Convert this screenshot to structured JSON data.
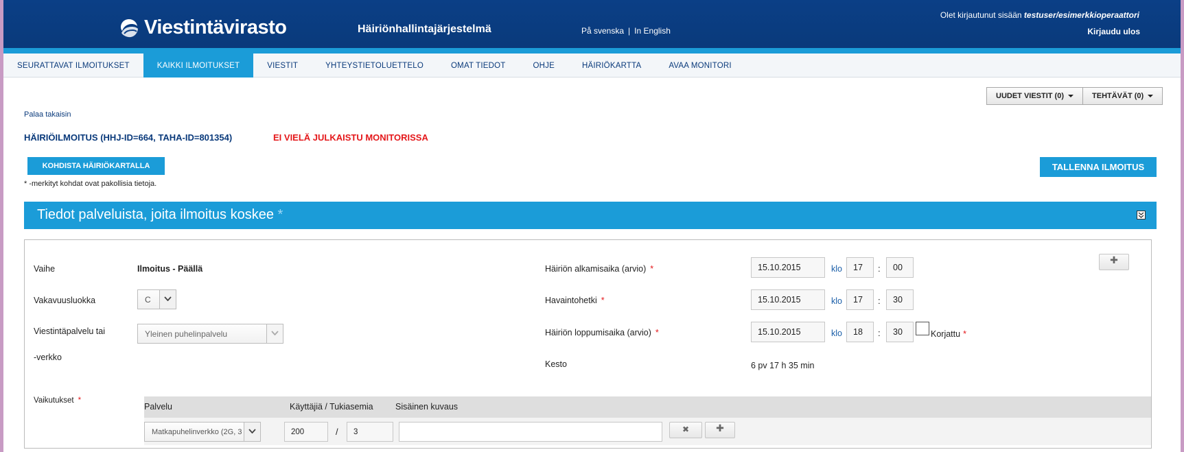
{
  "header": {
    "logo_text": "Viestintävirasto",
    "app_title": "Häiriönhallintajärjestelmä",
    "lang_sv": "På svenska",
    "lang_sep": "|",
    "lang_en": "In English",
    "login_prefix": "Olet kirjautunut sisään",
    "login_user": "testuser/esimerkkioperaattori",
    "logout": "Kirjaudu ulos"
  },
  "nav": {
    "items": [
      {
        "label": "SEURATTAVAT ILMOITUKSET"
      },
      {
        "label": "KAIKKI ILMOITUKSET"
      },
      {
        "label": "VIESTIT"
      },
      {
        "label": "YHTEYSTIETOLUETTELO"
      },
      {
        "label": "OMAT TIEDOT"
      },
      {
        "label": "OHJE"
      },
      {
        "label": "HÄIRIÖKARTTA"
      },
      {
        "label": "AVAA MONITORI"
      }
    ],
    "active_index": 1
  },
  "toolbar": {
    "new_messages": "UUDET VIESTIT (0)",
    "tasks": "TEHTÄVÄT (0)"
  },
  "page": {
    "back_link": "Palaa takaisin",
    "title": "HÄIRIÖILMOITUS (HHJ-ID=664, TAHA-ID=801354)",
    "status": "EI VIELÄ JULKAISTU MONITORISSA",
    "map_button": "KOHDISTA HÄIRIÖKARTALLA",
    "save_button": "TALLENNA ILMOITUS",
    "required_note": "* -merkityt kohdat ovat pakollisia tietoja."
  },
  "section": {
    "title": "Tiedot palveluista, joita ilmoitus koskee",
    "required_mark": "*"
  },
  "form": {
    "phase_label": "Vaihe",
    "phase_value": "Ilmoitus - Päällä",
    "severity_label": "Vakavuusluokka",
    "severity_value": "C",
    "service_label_1": "Viestintäpalvelu tai",
    "service_label_2": "-verkko",
    "service_value": "Yleinen puhelinpalvelu",
    "start_label": "Häiriön alkamisaika (arvio)",
    "start_date": "15.10.2015",
    "start_hour": "17",
    "start_min": "00",
    "observed_label": "Havaintohetki",
    "observed_date": "15.10.2015",
    "observed_hour": "17",
    "observed_min": "30",
    "end_label": "Häiriön loppumisaika (arvio)",
    "end_date": "15.10.2015",
    "end_hour": "18",
    "end_min": "30",
    "fixed_label": "Korjattu",
    "klo": "klo",
    "colon": ":",
    "duration_label": "Kesto",
    "duration_value": "6 pv 17 h 35 min",
    "star": "*",
    "impacts_label": "Vaikutukset",
    "impact_headers": {
      "service": "Palvelu",
      "users": "Käyttäjiä / Tukiasemia",
      "description": "Sisäinen kuvaus"
    },
    "impact_row": {
      "service": "Matkapuhelinverkko (2G, 3",
      "users": "200",
      "slash": "/",
      "stations": "3",
      "description": ""
    },
    "remove_glyph": "✖",
    "add_glyph": "✚"
  }
}
